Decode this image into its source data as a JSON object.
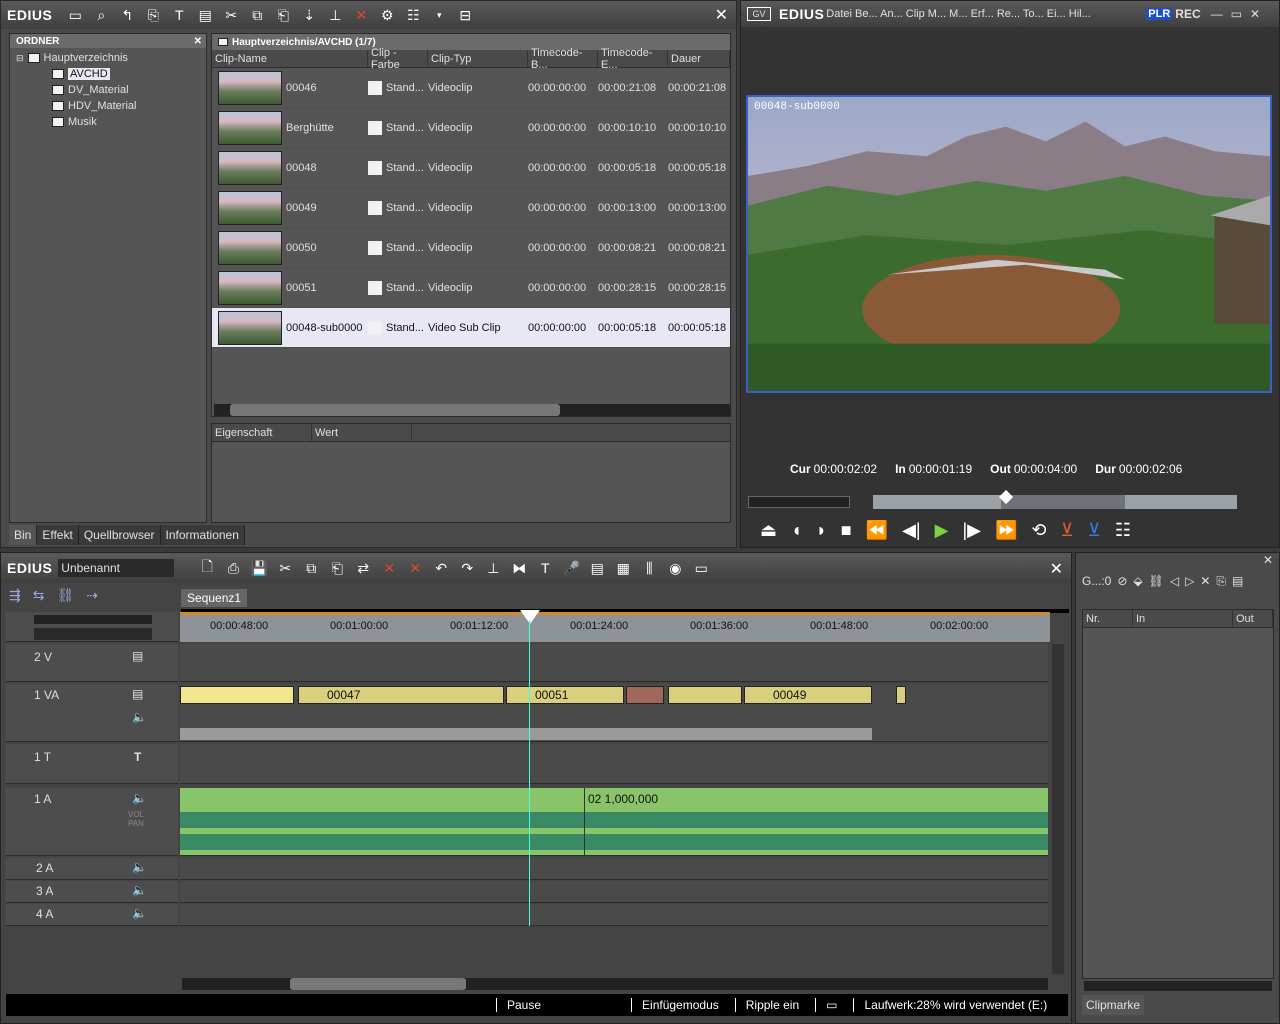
{
  "bin": {
    "logo": "EDIUS",
    "folder_header": "ORDNER",
    "folders": [
      {
        "label": "Hauptverzeichnis",
        "level": 0
      },
      {
        "label": "AVCHD",
        "level": 1
      },
      {
        "label": "DV_Material",
        "level": 1
      },
      {
        "label": "HDV_Material",
        "level": 1
      },
      {
        "label": "Musik",
        "level": 1
      }
    ],
    "path": "Hauptverzeichnis/AVCHD (1/7)",
    "columns": [
      "Clip-Name",
      "Clip - Farbe",
      "Clip-Typ",
      "Timecode-B...",
      "Timecode-E...",
      "Dauer"
    ],
    "clips": [
      {
        "name": "00046",
        "color": "Stand...",
        "type": "Videoclip",
        "tc_in": "00:00:00:00",
        "tc_out": "00:00:21:08",
        "dur": "00:00:21:08"
      },
      {
        "name": "Berghütte",
        "color": "Stand...",
        "type": "Videoclip",
        "tc_in": "00:00:00:00",
        "tc_out": "00:00:10:10",
        "dur": "00:00:10:10"
      },
      {
        "name": "00048",
        "color": "Stand...",
        "type": "Videoclip",
        "tc_in": "00:00:00:00",
        "tc_out": "00:00:05:18",
        "dur": "00:00:05:18"
      },
      {
        "name": "00049",
        "color": "Stand...",
        "type": "Videoclip",
        "tc_in": "00:00:00:00",
        "tc_out": "00:00:13:00",
        "dur": "00:00:13:00"
      },
      {
        "name": "00050",
        "color": "Stand...",
        "type": "Videoclip",
        "tc_in": "00:00:00:00",
        "tc_out": "00:00:08:21",
        "dur": "00:00:08:21"
      },
      {
        "name": "00051",
        "color": "Stand...",
        "type": "Videoclip",
        "tc_in": "00:00:00:00",
        "tc_out": "00:00:28:15",
        "dur": "00:00:28:15"
      },
      {
        "name": "00048-sub0000",
        "color": "Stand...",
        "type": "Video Sub Clip",
        "tc_in": "00:00:00:00",
        "tc_out": "00:00:05:18",
        "dur": "00:00:05:18"
      }
    ],
    "prop_columns": [
      "Eigenschaft",
      "Wert"
    ],
    "tabs": [
      "Bin",
      "Effekt",
      "Quellbrowser",
      "Informationen"
    ]
  },
  "player": {
    "logo": "EDIUS",
    "menu": "Datei Be... An... Clip M... M... Erf... Re... To... Ei... Hil...",
    "plr": "PLR",
    "rec": "REC",
    "overlay": "00048-sub0000",
    "cur_label": "Cur",
    "cur": "00:00:02:02",
    "in_label": "In",
    "in": "00:00:01:19",
    "out_label": "Out",
    "out": "00:00:04:00",
    "dur_label": "Dur",
    "dur": "00:00:02:06"
  },
  "timeline": {
    "logo": "EDIUS",
    "project": "Unbenannt",
    "sequence_tab": "Sequenz1",
    "ruler": [
      "00:00:48:00",
      "00:01:00:00",
      "00:01:12:00",
      "00:01:24:00",
      "00:01:36:00",
      "00:01:48:00",
      "00:02:00:00"
    ],
    "tracks": {
      "v2": "2 V",
      "va1": "1 VA",
      "t1": "1 T",
      "a1": "1 A",
      "a2": "2 A",
      "a3": "3 A",
      "a4": "4 A"
    },
    "clips": [
      "00047",
      "00051",
      "00049"
    ],
    "audio_label": "02 1,000,000",
    "vol_pan": "VOL PAN",
    "status": {
      "pause": "Pause",
      "mode": "Einfügemodus",
      "ripple": "Ripple ein",
      "drive": "Laufwerk:28% wird verwendet (E:)"
    }
  },
  "clipmarker": {
    "head": "G...:0",
    "columns": [
      "Nr.",
      "In",
      "Out"
    ],
    "tab": "Clipmarke"
  }
}
